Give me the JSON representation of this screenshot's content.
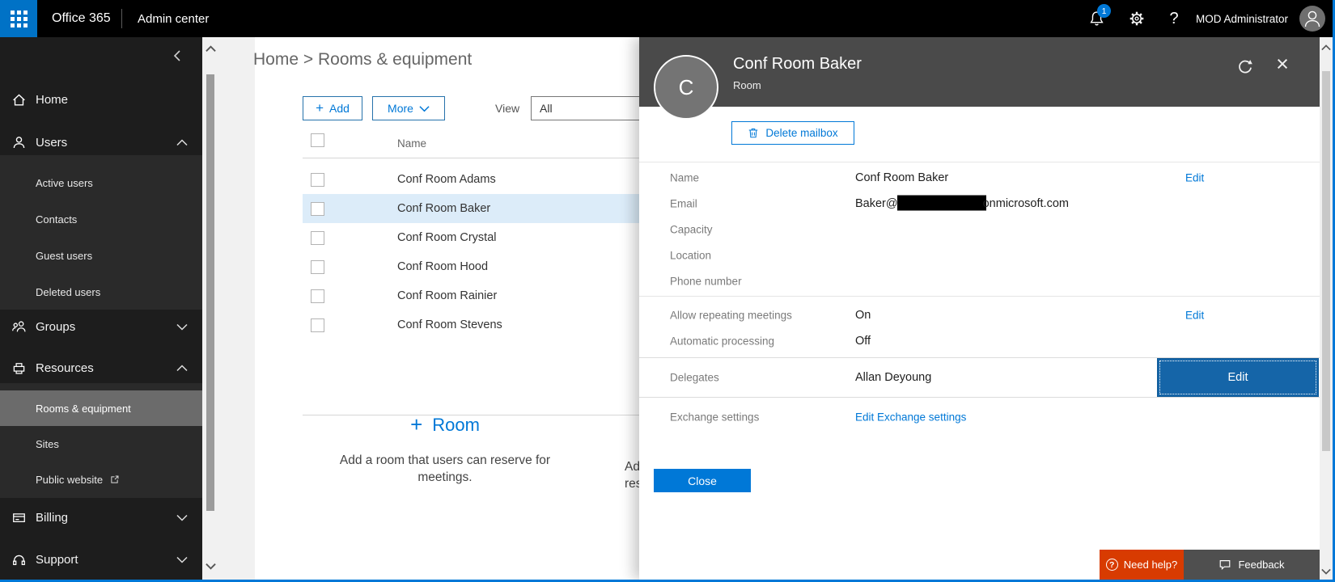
{
  "colors": {
    "accent_blue": "#0078d7",
    "waffle_blue": "#0072c6",
    "focused_edit_button": "#1565a8",
    "need_help_orange": "#d83b01",
    "feedback_gray": "#4f4f4f",
    "panel_header_gray": "#4a4a4a",
    "sidebar_bg": "#1d1d1d",
    "sidebar_selected": "#6b6b6b",
    "selected_row_blue": "#dcecf9"
  },
  "topbar": {
    "brand": "Office 365",
    "section": "Admin center",
    "notification_count": "1",
    "user_name": "MOD Administrator"
  },
  "sidebar": {
    "home": "Home",
    "users": "Users",
    "active_users": "Active users",
    "contacts": "Contacts",
    "guest_users": "Guest users",
    "deleted_users": "Deleted users",
    "groups": "Groups",
    "resources": "Resources",
    "rooms_equipment": "Rooms & equipment",
    "sites": "Sites",
    "public_website": "Public website",
    "billing": "Billing",
    "support": "Support"
  },
  "breadcrumb": {
    "home": "Home",
    "separator": " > ",
    "current": "Rooms & equipment"
  },
  "toolbar": {
    "add": "Add",
    "more": "More",
    "view_label": "View",
    "view_value": "All"
  },
  "table": {
    "name_header": "Name",
    "rows": [
      {
        "name": "Conf Room Adams"
      },
      {
        "name": "Conf Room Baker",
        "selected": true
      },
      {
        "name": "Conf Room Crystal"
      },
      {
        "name": "Conf Room Hood"
      },
      {
        "name": "Conf Room Rainier"
      },
      {
        "name": "Conf Room Stevens"
      }
    ]
  },
  "add_room_card": {
    "title": "Room",
    "description": "Add a room that users can reserve for meetings."
  },
  "clipped_card_fragment": {
    "line1": "Add",
    "line2": "res"
  },
  "panel": {
    "title": "Conf Room Baker",
    "subtitle": "Room",
    "avatar_letter": "C",
    "delete_button": "Delete mailbox",
    "fields": {
      "name": {
        "label": "Name",
        "value": "Conf Room Baker",
        "edit": "Edit"
      },
      "email": {
        "label": "Email",
        "prefix": "Baker@",
        "suffix": "onmicrosoft.com"
      },
      "capacity": {
        "label": "Capacity"
      },
      "location": {
        "label": "Location"
      },
      "phone": {
        "label": "Phone number"
      },
      "repeating": {
        "label": "Allow repeating meetings",
        "value": "On",
        "edit": "Edit"
      },
      "auto_processing": {
        "label": "Automatic processing",
        "value": "Off"
      },
      "delegates": {
        "label": "Delegates",
        "value": "Allan Deyoung",
        "edit": "Edit"
      },
      "exchange": {
        "label": "Exchange settings",
        "link": "Edit Exchange settings"
      }
    },
    "close_button": "Close"
  },
  "footer": {
    "need_help": "Need help?",
    "feedback": "Feedback"
  }
}
